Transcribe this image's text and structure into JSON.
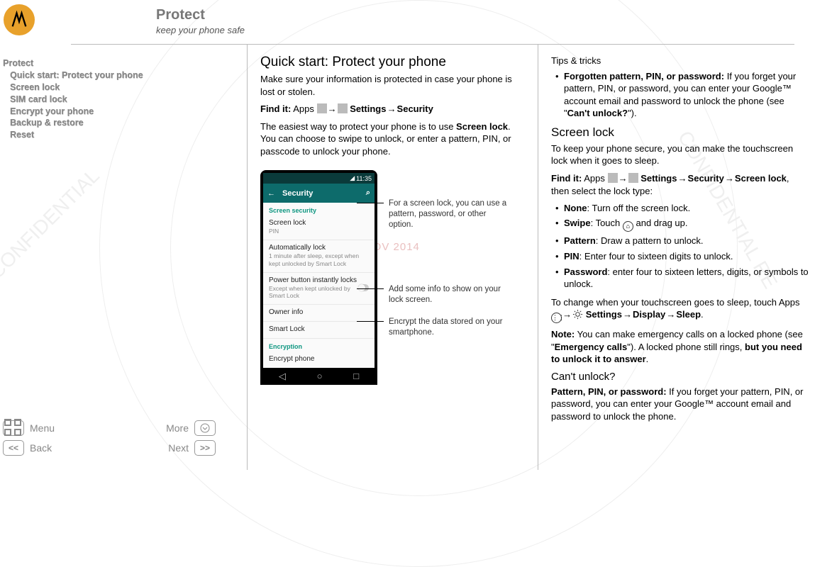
{
  "header": {
    "title": "Protect",
    "subtitle": "keep your phone safe"
  },
  "watermark_date": "24 NOV 2014",
  "toc": {
    "items": [
      {
        "label": "Protect",
        "indent": false
      },
      {
        "label": "Quick start: Protect your phone",
        "indent": true
      },
      {
        "label": "Screen lock",
        "indent": true
      },
      {
        "label": "SIM card lock",
        "indent": true
      },
      {
        "label": "Encrypt your phone",
        "indent": true
      },
      {
        "label": "Backup & restore",
        "indent": true
      },
      {
        "label": "Reset",
        "indent": true
      }
    ]
  },
  "nav": {
    "menu": "Menu",
    "more": "More",
    "back": "Back",
    "next": "Next"
  },
  "colA": {
    "h": "Quick start: Protect your phone",
    "p1": "Make sure your information is protected in case your phone is lost or stolen.",
    "findit_label": "Find it:",
    "findit_apps": "Apps",
    "findit_settings": "Settings",
    "findit_security": "Security",
    "p2a": "The easiest way to protect your phone is to use ",
    "p2b": "Screen lock",
    "p2c": ". You can choose to swipe to unlock, or enter a pattern, PIN, or passcode to unlock your phone."
  },
  "phone": {
    "time": "11:35",
    "appbar": "Security",
    "sect1": "Screen security",
    "r1t": "Screen lock",
    "r1s": "PIN",
    "r2t": "Automatically lock",
    "r2s": "1 minute after sleep, except when kept unlocked by Smart Lock",
    "r3t": "Power button instantly locks",
    "r3s": "Except when kept unlocked by Smart Lock",
    "r4t": "Owner info",
    "r5t": "Smart Lock",
    "sect2": "Encryption",
    "r6t": "Encrypt phone"
  },
  "annotations": {
    "a1": "For a screen lock, you can use a pattern, password, or other option.",
    "a2": "Add some info to show on your lock screen.",
    "a3": "Encrypt the data stored on your smartphone."
  },
  "colB": {
    "tips_h": "Tips & tricks",
    "tip1b": "Forgotten pattern, PIN, or password:",
    "tip1": " If you forget your pattern, PIN, or password, you can enter your Google™ account email and password to unlock the phone (see \"",
    "tip1c": "Can't unlock?",
    "tip1d": "\").",
    "sl_h": "Screen lock",
    "sl_p1": "To keep your phone secure, you can make the touchscreen lock when it goes to sleep.",
    "findit_label": "Find it:",
    "findit_apps": "Apps",
    "findit_settings": "Settings",
    "findit_security": "Security",
    "findit_screenlock": "Screen lock",
    "findit_tail": ", then select the lock type:",
    "opts": {
      "none_b": "None",
      "none_t": ": Turn off the screen lock.",
      "swipe_b": "Swipe",
      "swipe_t1": ": Touch ",
      "swipe_t2": " and drag up.",
      "pattern_b": "Pattern",
      "pattern_t": ": Draw a pattern to unlock.",
      "pin_b": "PIN",
      "pin_t": ": Enter four to sixteen digits to unlock.",
      "pw_b": "Password",
      "pw_t": ": enter four to sixteen letters, digits, or symbols to unlock."
    },
    "sleep_p1": "To change when your touchscreen goes to sleep, touch Apps ",
    "sleep_settings": "Settings",
    "sleep_display": "Display",
    "sleep_sleep": "Sleep",
    "note_b": "Note:",
    "note_t1": " You can make emergency calls on a locked phone (see \"",
    "note_em": "Emergency calls",
    "note_t2": "\"). A locked phone still rings, ",
    "note_t3": "but you need to unlock it to answer",
    "note_t4": ".",
    "cu_h": "Can't unlock?",
    "cu_b": "Pattern, PIN, or password:",
    "cu_t": " If you forget your pattern, PIN, or password, you can enter your Google™ account email and password to unlock the phone."
  }
}
